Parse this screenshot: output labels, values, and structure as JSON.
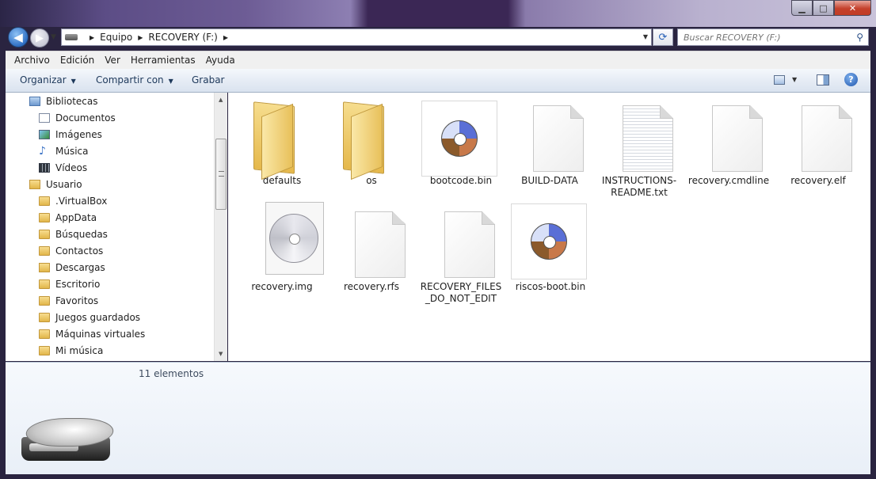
{
  "window": {
    "min_symbol": "▁",
    "max_symbol": "□",
    "close_symbol": "✕"
  },
  "nav": {
    "back_symbol": "◀",
    "forward_symbol": "▶",
    "dropdown_symbol": "▼"
  },
  "address": {
    "crumbs": [
      "Equipo",
      "RECOVERY (F:)"
    ],
    "separator": "▶",
    "dropdown_symbol": "▼",
    "refresh_symbol": "⟳"
  },
  "search": {
    "placeholder": "Buscar RECOVERY (F:)",
    "icon_symbol": "⚲"
  },
  "menubar": [
    "Archivo",
    "Edición",
    "Ver",
    "Herramientas",
    "Ayuda"
  ],
  "commandbar": {
    "organize": "Organizar",
    "share": "Compartir con",
    "burn": "Grabar",
    "caret": "▼",
    "help": "?"
  },
  "navpane": {
    "items": [
      {
        "label": "Bibliotecas",
        "icon": "library-icon"
      },
      {
        "label": "Documentos",
        "icon": "documents-icon"
      },
      {
        "label": "Imágenes",
        "icon": "pictures-icon"
      },
      {
        "label": "Música",
        "icon": "music-icon"
      },
      {
        "label": "Vídeos",
        "icon": "videos-icon"
      },
      {
        "label": "Usuario",
        "icon": "user-folder-icon"
      },
      {
        "label": ".VirtualBox",
        "icon": "folder-icon"
      },
      {
        "label": "AppData",
        "icon": "folder-icon"
      },
      {
        "label": "Búsquedas",
        "icon": "searches-folder-icon"
      },
      {
        "label": "Contactos",
        "icon": "contacts-folder-icon"
      },
      {
        "label": "Descargas",
        "icon": "downloads-folder-icon"
      },
      {
        "label": "Escritorio",
        "icon": "desktop-folder-icon"
      },
      {
        "label": "Favoritos",
        "icon": "favorites-folder-icon"
      },
      {
        "label": "Juegos guardados",
        "icon": "saved-games-folder-icon"
      },
      {
        "label": "Máquinas virtuales",
        "icon": "virtual-machines-folder-icon"
      },
      {
        "label": "Mi música",
        "icon": "my-music-folder-icon"
      }
    ],
    "scroll_up": "▲",
    "scroll_down": "▼"
  },
  "files": [
    {
      "name": "defaults",
      "type": "folder"
    },
    {
      "name": "os",
      "type": "folder"
    },
    {
      "name": "bootcode.bin",
      "type": "disc-image"
    },
    {
      "name": "BUILD-DATA",
      "type": "generic-file"
    },
    {
      "name": "INSTRUCTIONS-README.txt",
      "type": "text-file"
    },
    {
      "name": "recovery.cmdline",
      "type": "generic-file"
    },
    {
      "name": "recovery.elf",
      "type": "generic-file"
    },
    {
      "name": "recovery.img",
      "type": "optical-disc-image"
    },
    {
      "name": "recovery.rfs",
      "type": "generic-file"
    },
    {
      "name": "RECOVERY_FILES_DO_NOT_EDIT",
      "type": "generic-file"
    },
    {
      "name": "riscos-boot.bin",
      "type": "disc-image"
    }
  ],
  "details": {
    "count": "11 elementos"
  }
}
